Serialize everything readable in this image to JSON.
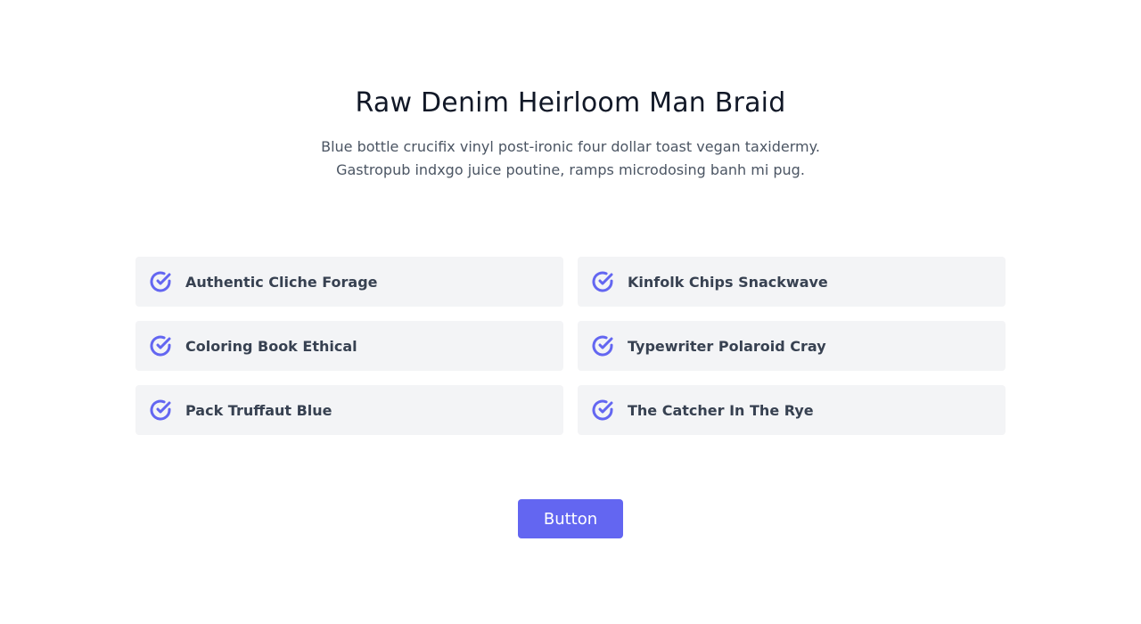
{
  "header": {
    "title": "Raw Denim Heirloom Man Braid",
    "subtitle": "Blue bottle crucifix vinyl post-ironic four dollar toast vegan taxidermy. Gastropub indxgo juice poutine, ramps microdosing banh mi pug."
  },
  "features": [
    {
      "label": "Authentic Cliche Forage",
      "icon": "check-circle-icon"
    },
    {
      "label": "Kinfolk Chips Snackwave",
      "icon": "check-circle-icon"
    },
    {
      "label": "Coloring Book Ethical",
      "icon": "check-circle-icon"
    },
    {
      "label": "Typewriter Polaroid Cray",
      "icon": "check-circle-icon"
    },
    {
      "label": "Pack Truffaut Blue",
      "icon": "check-circle-icon"
    },
    {
      "label": "The Catcher In The Rye",
      "icon": "check-circle-icon"
    }
  ],
  "cta": {
    "label": "Button"
  },
  "colors": {
    "accent": "#6366f1",
    "card_bg": "#f3f4f6",
    "title": "#111827",
    "body": "#4b5563"
  }
}
